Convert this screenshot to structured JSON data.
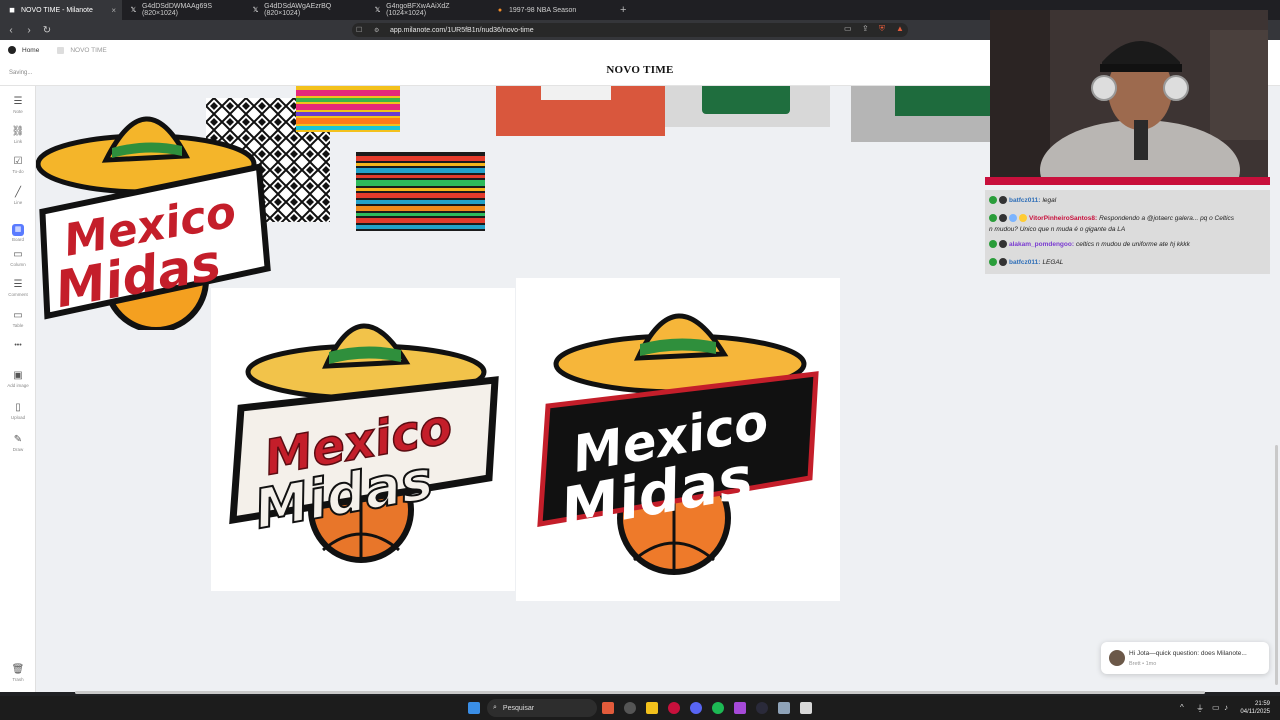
{
  "browser": {
    "tabs": [
      {
        "label": "NOVO TIME - Milanote",
        "active": true
      },
      {
        "label": "G4dDSdDWMAAg69S (820×1024)",
        "active": false
      },
      {
        "label": "G4dDSdAWgAEzrBQ (820×1024)",
        "active": false
      },
      {
        "label": "G4ngoBFXwAAiXdZ (1024×1024)",
        "active": false
      },
      {
        "label": "1997-98 NBA Season",
        "active": false
      }
    ],
    "new_tab": "+",
    "close_glyph": "×",
    "url": "app.milanote.com/1UR5fB1n/nud36/novo-time"
  },
  "app": {
    "breadcrumb_home": "Home",
    "breadcrumb_current": "NOVO TIME",
    "saving_status": "Saving...",
    "board_title": "NOVO TIME"
  },
  "sidebar": {
    "tools": [
      {
        "label": "Note",
        "icon": "note-icon",
        "glyph": "☰"
      },
      {
        "label": "Link",
        "icon": "link-icon",
        "glyph": "🔗"
      },
      {
        "label": "To-do",
        "icon": "todo-icon",
        "glyph": "☑"
      },
      {
        "label": "Line",
        "icon": "line-icon",
        "glyph": "╱"
      },
      {
        "label": "Board",
        "icon": "board-icon",
        "glyph": "▦"
      },
      {
        "label": "Column",
        "icon": "column-icon",
        "glyph": "▭"
      },
      {
        "label": "Comment",
        "icon": "comment-icon",
        "glyph": "☰"
      },
      {
        "label": "Table",
        "icon": "table-icon",
        "glyph": "▭"
      },
      {
        "label": "",
        "icon": "more-icon",
        "glyph": "•••"
      },
      {
        "label": "Add image",
        "icon": "image-icon",
        "glyph": "🖼"
      },
      {
        "label": "Upload",
        "icon": "upload-icon",
        "glyph": "📄"
      },
      {
        "label": "Draw",
        "icon": "draw-icon",
        "glyph": "✎"
      }
    ],
    "trash": "Trash"
  },
  "logo": {
    "word1": "Mexico",
    "word2": "Midas"
  },
  "chat": {
    "messages": [
      {
        "user": "batfcz011:",
        "text": "legal"
      },
      {
        "user": "VitorPinheiroSantos8:",
        "text": "Respondendo a @jotaerc galera... pq o Celtics"
      },
      {
        "user": "",
        "text": "n mudou? Unico que n muda é o gigante da LA"
      },
      {
        "user": "alakam_pomdengoo:",
        "text": "celtics n mudou de uniforme ate hj kkkk"
      },
      {
        "user": "batfcz011:",
        "text": "LEGAL"
      }
    ]
  },
  "toast": {
    "text": "Hi Jota—quick question: does Milanote...",
    "meta": "Brett • 1mo"
  },
  "taskbar": {
    "search": "Pesquisar",
    "time": "21:59",
    "date": "04/11/2025"
  },
  "colors": {
    "logo_red": "#c41e2a",
    "logo_hat": "#f4b52a",
    "logo_ball": "#e87b2a",
    "chat_green": "#2a9d3a",
    "cam_strip": "#c8103c"
  }
}
